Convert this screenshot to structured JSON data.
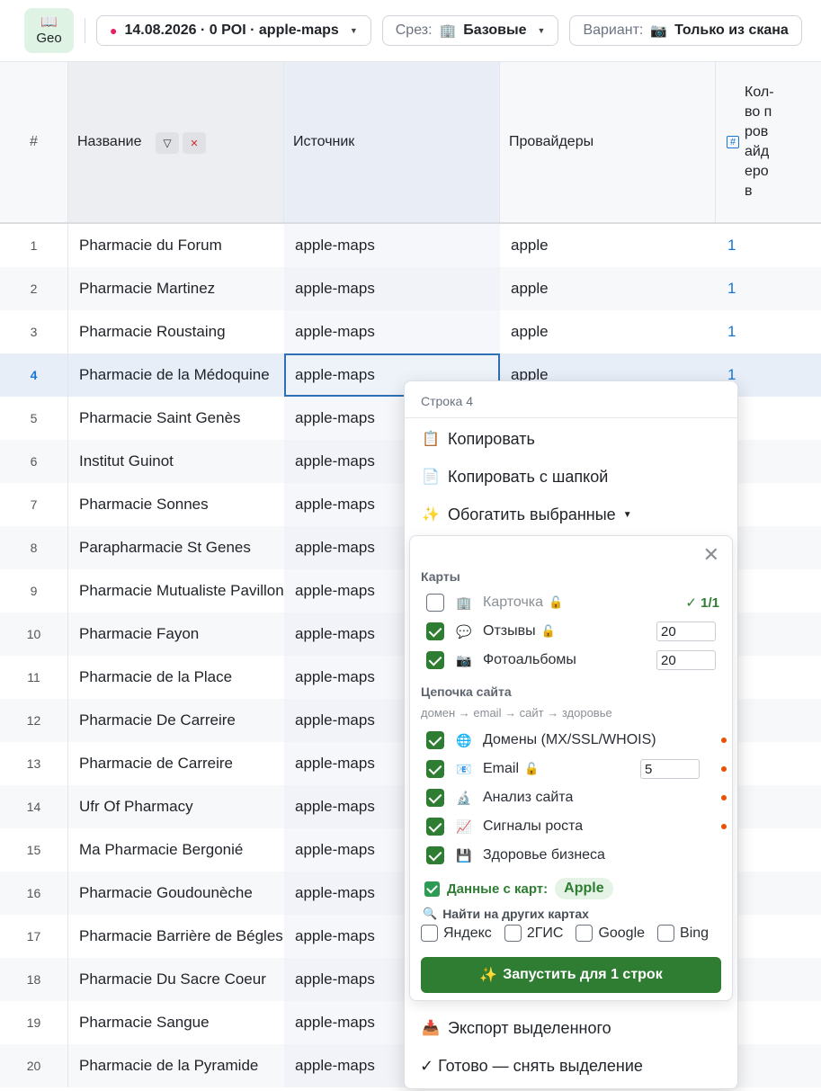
{
  "topbar": {
    "logo_label": "Geo",
    "dataset_label": "14.08.2026 · 0 POI · apple-maps",
    "slice_prefix": "Срез:",
    "slice_value": "Базовые",
    "variant_prefix": "Вариант:",
    "variant_value": "Только из скана"
  },
  "table": {
    "headers": {
      "num": "#",
      "name": "Название",
      "source": "Источник",
      "providers": "Провайдеры",
      "count": "Кол-во провайдеров"
    },
    "rows": [
      {
        "num": "1",
        "name": "Pharmacie du Forum",
        "source": "apple-maps",
        "providers": "apple",
        "count": "1"
      },
      {
        "num": "2",
        "name": "Pharmacie Martinez",
        "source": "apple-maps",
        "providers": "apple",
        "count": "1"
      },
      {
        "num": "3",
        "name": "Pharmacie Roustaing",
        "source": "apple-maps",
        "providers": "apple",
        "count": "1"
      },
      {
        "num": "4",
        "name": "Pharmacie de la Médoquine",
        "source": "apple-maps",
        "providers": "apple",
        "count": "1"
      },
      {
        "num": "5",
        "name": "Pharmacie Saint Genès",
        "source": "apple-maps",
        "providers": "",
        "count": ""
      },
      {
        "num": "6",
        "name": "Institut Guinot",
        "source": "apple-maps",
        "providers": "",
        "count": ""
      },
      {
        "num": "7",
        "name": "Pharmacie Sonnes",
        "source": "apple-maps",
        "providers": "",
        "count": ""
      },
      {
        "num": "8",
        "name": "Parapharmacie St Genes",
        "source": "apple-maps",
        "providers": "",
        "count": ""
      },
      {
        "num": "9",
        "name": "Pharmacie Mutualiste Pavillon",
        "source": "apple-maps",
        "providers": "",
        "count": ""
      },
      {
        "num": "10",
        "name": "Pharmacie Fayon",
        "source": "apple-maps",
        "providers": "",
        "count": ""
      },
      {
        "num": "11",
        "name": "Pharmacie de la Place",
        "source": "apple-maps",
        "providers": "",
        "count": ""
      },
      {
        "num": "12",
        "name": "Pharmacie De Carreire",
        "source": "apple-maps",
        "providers": "",
        "count": ""
      },
      {
        "num": "13",
        "name": "Pharmacie de Carreire",
        "source": "apple-maps",
        "providers": "",
        "count": ""
      },
      {
        "num": "14",
        "name": "Ufr Of Pharmacy",
        "source": "apple-maps",
        "providers": "",
        "count": ""
      },
      {
        "num": "15",
        "name": "Ma Pharmacie Bergonié",
        "source": "apple-maps",
        "providers": "",
        "count": ""
      },
      {
        "num": "16",
        "name": "Pharmacie Goudounèche",
        "source": "apple-maps",
        "providers": "",
        "count": ""
      },
      {
        "num": "17",
        "name": "Pharmacie Barrière de Bégles",
        "source": "apple-maps",
        "providers": "",
        "count": ""
      },
      {
        "num": "18",
        "name": "Pharmacie Du Sacre Coeur",
        "source": "apple-maps",
        "providers": "",
        "count": ""
      },
      {
        "num": "19",
        "name": "Pharmacie Sangue",
        "source": "apple-maps",
        "providers": "",
        "count": ""
      },
      {
        "num": "20",
        "name": "Pharmacie de la Pyramide",
        "source": "apple-maps",
        "providers": "",
        "count": ""
      }
    ]
  },
  "context_menu": {
    "title": "Строка 4",
    "copy": "Копировать",
    "copy_header": "Копировать с шапкой",
    "enrich": "Обогатить выбранные",
    "export": "Экспорт выделенного",
    "done": "✓ Готово — снять выделение"
  },
  "enrich_panel": {
    "maps_section": "Карты",
    "card_label": "Карточка",
    "card_status": "✓ 1/1",
    "reviews_label": "Отзывы",
    "reviews_value": "20",
    "photos_label": "Фотоальбомы",
    "photos_value": "20",
    "chain_section": "Цепочка сайта",
    "chain_hint": "домен → email → сайт → здоровье",
    "domains_label": "Домены (MX/SSL/WHOIS)",
    "email_label": "Email",
    "email_value": "5",
    "site_label": "Анализ сайта",
    "growth_label": "Сигналы роста",
    "health_label": "Здоровье бизнеса",
    "maps_data_label": "Данные с карт:",
    "maps_data_value": "Apple",
    "find_other_label": "Найти на других картах",
    "other_maps": [
      "Яндекс",
      "2ГИС",
      "Google",
      "Bing"
    ],
    "run_button": "Запустить для 1 строк"
  },
  "colors": {
    "accent_green": "#2e7d32",
    "link_blue": "#1976d2",
    "selection_blue": "#2f6fb5",
    "warning_dot": "#e65100"
  }
}
